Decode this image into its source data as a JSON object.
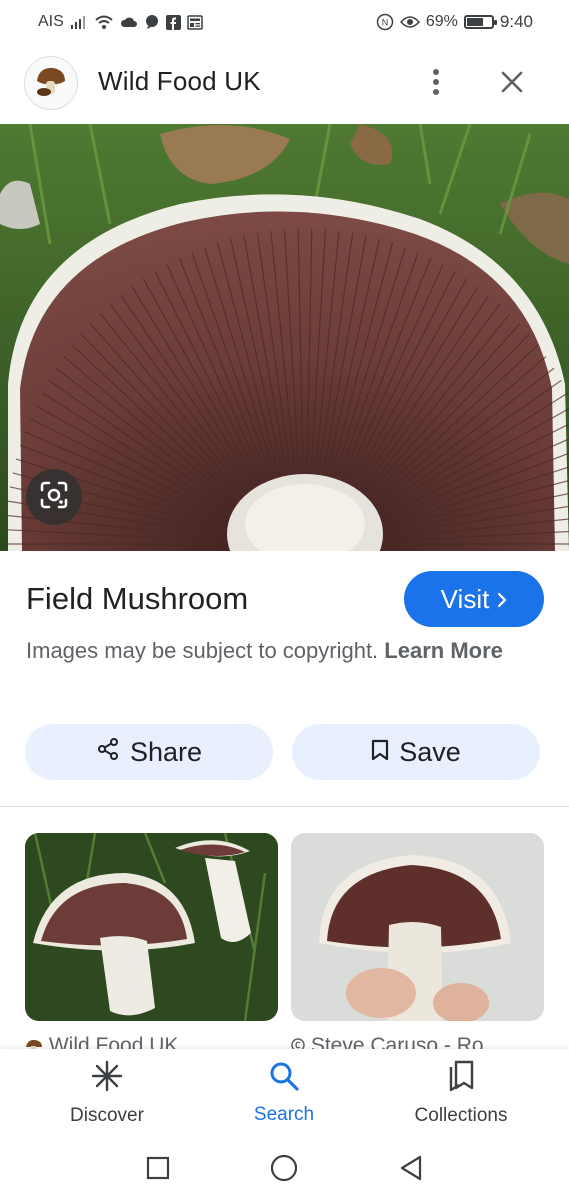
{
  "status_bar": {
    "carrier": "AIS",
    "battery_percent": "69%",
    "battery_level": 0.69,
    "time": "9:40"
  },
  "header": {
    "site_name": "Wild Food UK",
    "icons": {
      "menu": "more-vertical-icon",
      "close": "close-icon",
      "logo": "mushroom-logo-icon"
    }
  },
  "hero": {
    "lens_icon": "google-lens-icon"
  },
  "result": {
    "title": "Field Mushroom",
    "visit_label": "Visit",
    "copyright_text": "Images may be subject to copyright.",
    "learn_more": "Learn More",
    "share_label": "Share",
    "save_label": "Save"
  },
  "related": [
    {
      "source": "Wild Food UK"
    },
    {
      "source": "Steve Caruso - Ro"
    }
  ],
  "bottom_nav": {
    "discover": "Discover",
    "search": "Search",
    "collections": "Collections",
    "active": "search"
  },
  "colors": {
    "accent": "#1a73e8",
    "pill_bg": "#e8f0fe",
    "text_primary": "#202124",
    "text_secondary": "#5f6368"
  }
}
